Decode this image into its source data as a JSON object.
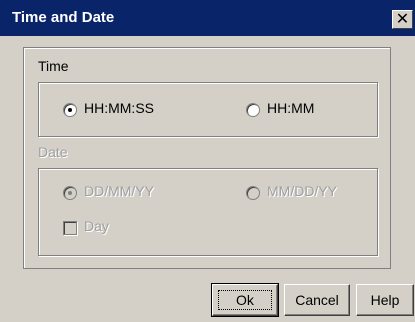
{
  "window": {
    "title": "Time and Date",
    "close_glyph": "✕"
  },
  "time_group": {
    "label": "Time",
    "options": [
      {
        "label": "HH:MM:SS",
        "selected": true
      },
      {
        "label": "HH:MM",
        "selected": false
      }
    ]
  },
  "date_group": {
    "label": "Date",
    "disabled": true,
    "options": [
      {
        "label": "DD/MM/YY",
        "selected": true
      },
      {
        "label": "MM/DD/YY",
        "selected": false
      }
    ],
    "day_checkbox": {
      "label": "Day",
      "checked": false
    }
  },
  "buttons": {
    "ok": "Ok",
    "cancel": "Cancel",
    "help": "Help"
  },
  "colors": {
    "titlebar": "#0a246a",
    "face": "#d4d0c8",
    "disabled_text": "#a0a0a0"
  }
}
